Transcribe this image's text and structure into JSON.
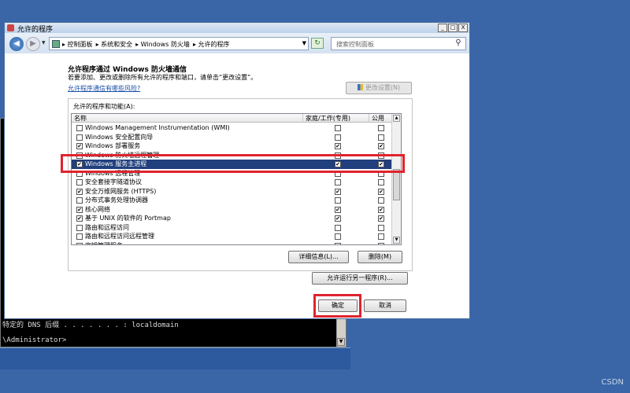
{
  "window": {
    "title": "允许的程序",
    "controls": {
      "minimize": "_",
      "maximize": "□",
      "close": "X"
    }
  },
  "address": {
    "back_label": "◀",
    "forward_label": "▶",
    "crumbs": [
      "▸ 控制面板",
      "▸ 系统和安全",
      "▸ Windows 防火墙",
      "▸ 允许的程序"
    ],
    "search_placeholder": "搜索控制面板"
  },
  "page": {
    "title": "允许程序通过 Windows 防火墙通信",
    "description": "若要添加、更改或删除所有允许的程序和端口，请单击“更改设置”。",
    "risk_link": "允许程序通信有哪些风险?",
    "change_settings_button": "更改设置(N)"
  },
  "list": {
    "group_label": "允许的程序和功能(A):",
    "headers": {
      "name": "名称",
      "home": "家庭/工作(专用)",
      "public": "公用"
    },
    "rows": [
      {
        "name": "Windows Management Instrumentation (WMI)",
        "checked": false,
        "home": false,
        "public": false,
        "selected": false
      },
      {
        "name": "Windows 安全配置向导",
        "checked": false,
        "home": false,
        "public": false,
        "selected": false
      },
      {
        "name": "Windows 部署服务",
        "checked": true,
        "home": true,
        "public": true,
        "selected": false
      },
      {
        "name": "Windows 防火墙远程管理",
        "checked": false,
        "home": false,
        "public": false,
        "selected": false
      },
      {
        "name": "Windows 服务主进程",
        "checked": true,
        "home": true,
        "public": true,
        "selected": true
      },
      {
        "name": "Windows 远程管理",
        "checked": false,
        "home": false,
        "public": false,
        "selected": false
      },
      {
        "name": "安全套接字隧道协议",
        "checked": false,
        "home": false,
        "public": false,
        "selected": false
      },
      {
        "name": "安全万维网服务 (HTTPS)",
        "checked": true,
        "home": true,
        "public": true,
        "selected": false
      },
      {
        "name": "分布式事务处理协调器",
        "checked": false,
        "home": false,
        "public": false,
        "selected": false
      },
      {
        "name": "核心网络",
        "checked": true,
        "home": true,
        "public": true,
        "selected": false
      },
      {
        "name": "基于 UNIX 的软件的 Portmap",
        "checked": true,
        "home": true,
        "public": true,
        "selected": false
      },
      {
        "name": "路由和远程访问",
        "checked": false,
        "home": false,
        "public": false,
        "selected": false
      },
      {
        "name": "路由和远程访问远程管理",
        "checked": false,
        "home": false,
        "public": false,
        "selected": false
      },
      {
        "name": "密钥管理服务",
        "checked": false,
        "home": false,
        "public": false,
        "selected": false
      }
    ]
  },
  "buttons": {
    "details": "详细信息(L)...",
    "delete": "删除(M)",
    "allow_another": "允许运行另一程序(R)...",
    "ok": "确定",
    "cancel": "取消"
  },
  "console": {
    "dns_line": "特定的 DNS 后缀 . . . . . . . : localdomain",
    "prompt_line": "\\Administrator>"
  },
  "watermark": "CSDN",
  "colors": {
    "desktop": "#3a66a8",
    "selection": "#213f7c",
    "highlight": "#e0232f"
  }
}
